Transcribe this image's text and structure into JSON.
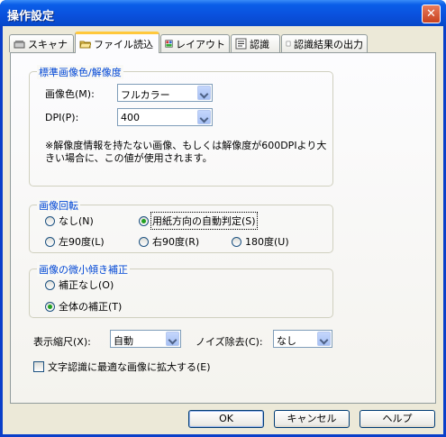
{
  "window": {
    "title": "操作設定",
    "close_symbol": "✕"
  },
  "tabs": [
    {
      "label": "スキャナ",
      "icon": "scanner-icon",
      "active": false
    },
    {
      "label": "ファイル読込",
      "icon": "open-folder-icon",
      "active": true
    },
    {
      "label": "レイアウト",
      "icon": "layout-icon",
      "active": false
    },
    {
      "label": "認識",
      "icon": "recognition-icon",
      "active": false
    },
    {
      "label": "認識結果の出力",
      "icon": "",
      "active": false
    }
  ],
  "resolution_group": {
    "title": "標準画像色/解像度",
    "color_label": "画像色(M):",
    "color_value": "フルカラー",
    "dpi_label": "DPI(P):",
    "dpi_value": "400",
    "note_line1": "※解像度情報を持たない画像、もしくは解像度が600DPIより大",
    "note_line2": "きい場合に、この値が使用されます。"
  },
  "rotation_group": {
    "title": "画像回転",
    "options": [
      {
        "label": "なし(N)",
        "selected": false
      },
      {
        "label": "用紙方向の自動判定(S)",
        "selected": true
      },
      {
        "label": "左90度(L)",
        "selected": false
      },
      {
        "label": "右90度(R)",
        "selected": false
      },
      {
        "label": "180度(U)",
        "selected": false
      }
    ]
  },
  "skew_group": {
    "title": "画像の微小傾き補正",
    "options": [
      {
        "label": "補正なし(O)",
        "selected": false
      },
      {
        "label": "全体の補正(T)",
        "selected": true
      }
    ]
  },
  "display": {
    "scale_label": "表示縮尺(X):",
    "scale_value": "自動",
    "noise_label": "ノイズ除去(C):",
    "noise_value": "なし"
  },
  "enlarge_checkbox": {
    "label": "文字認識に最適な画像に拡大する(E)",
    "checked": false
  },
  "buttons": {
    "ok": "OK",
    "cancel": "キャンセル",
    "help": "ヘルプ"
  }
}
